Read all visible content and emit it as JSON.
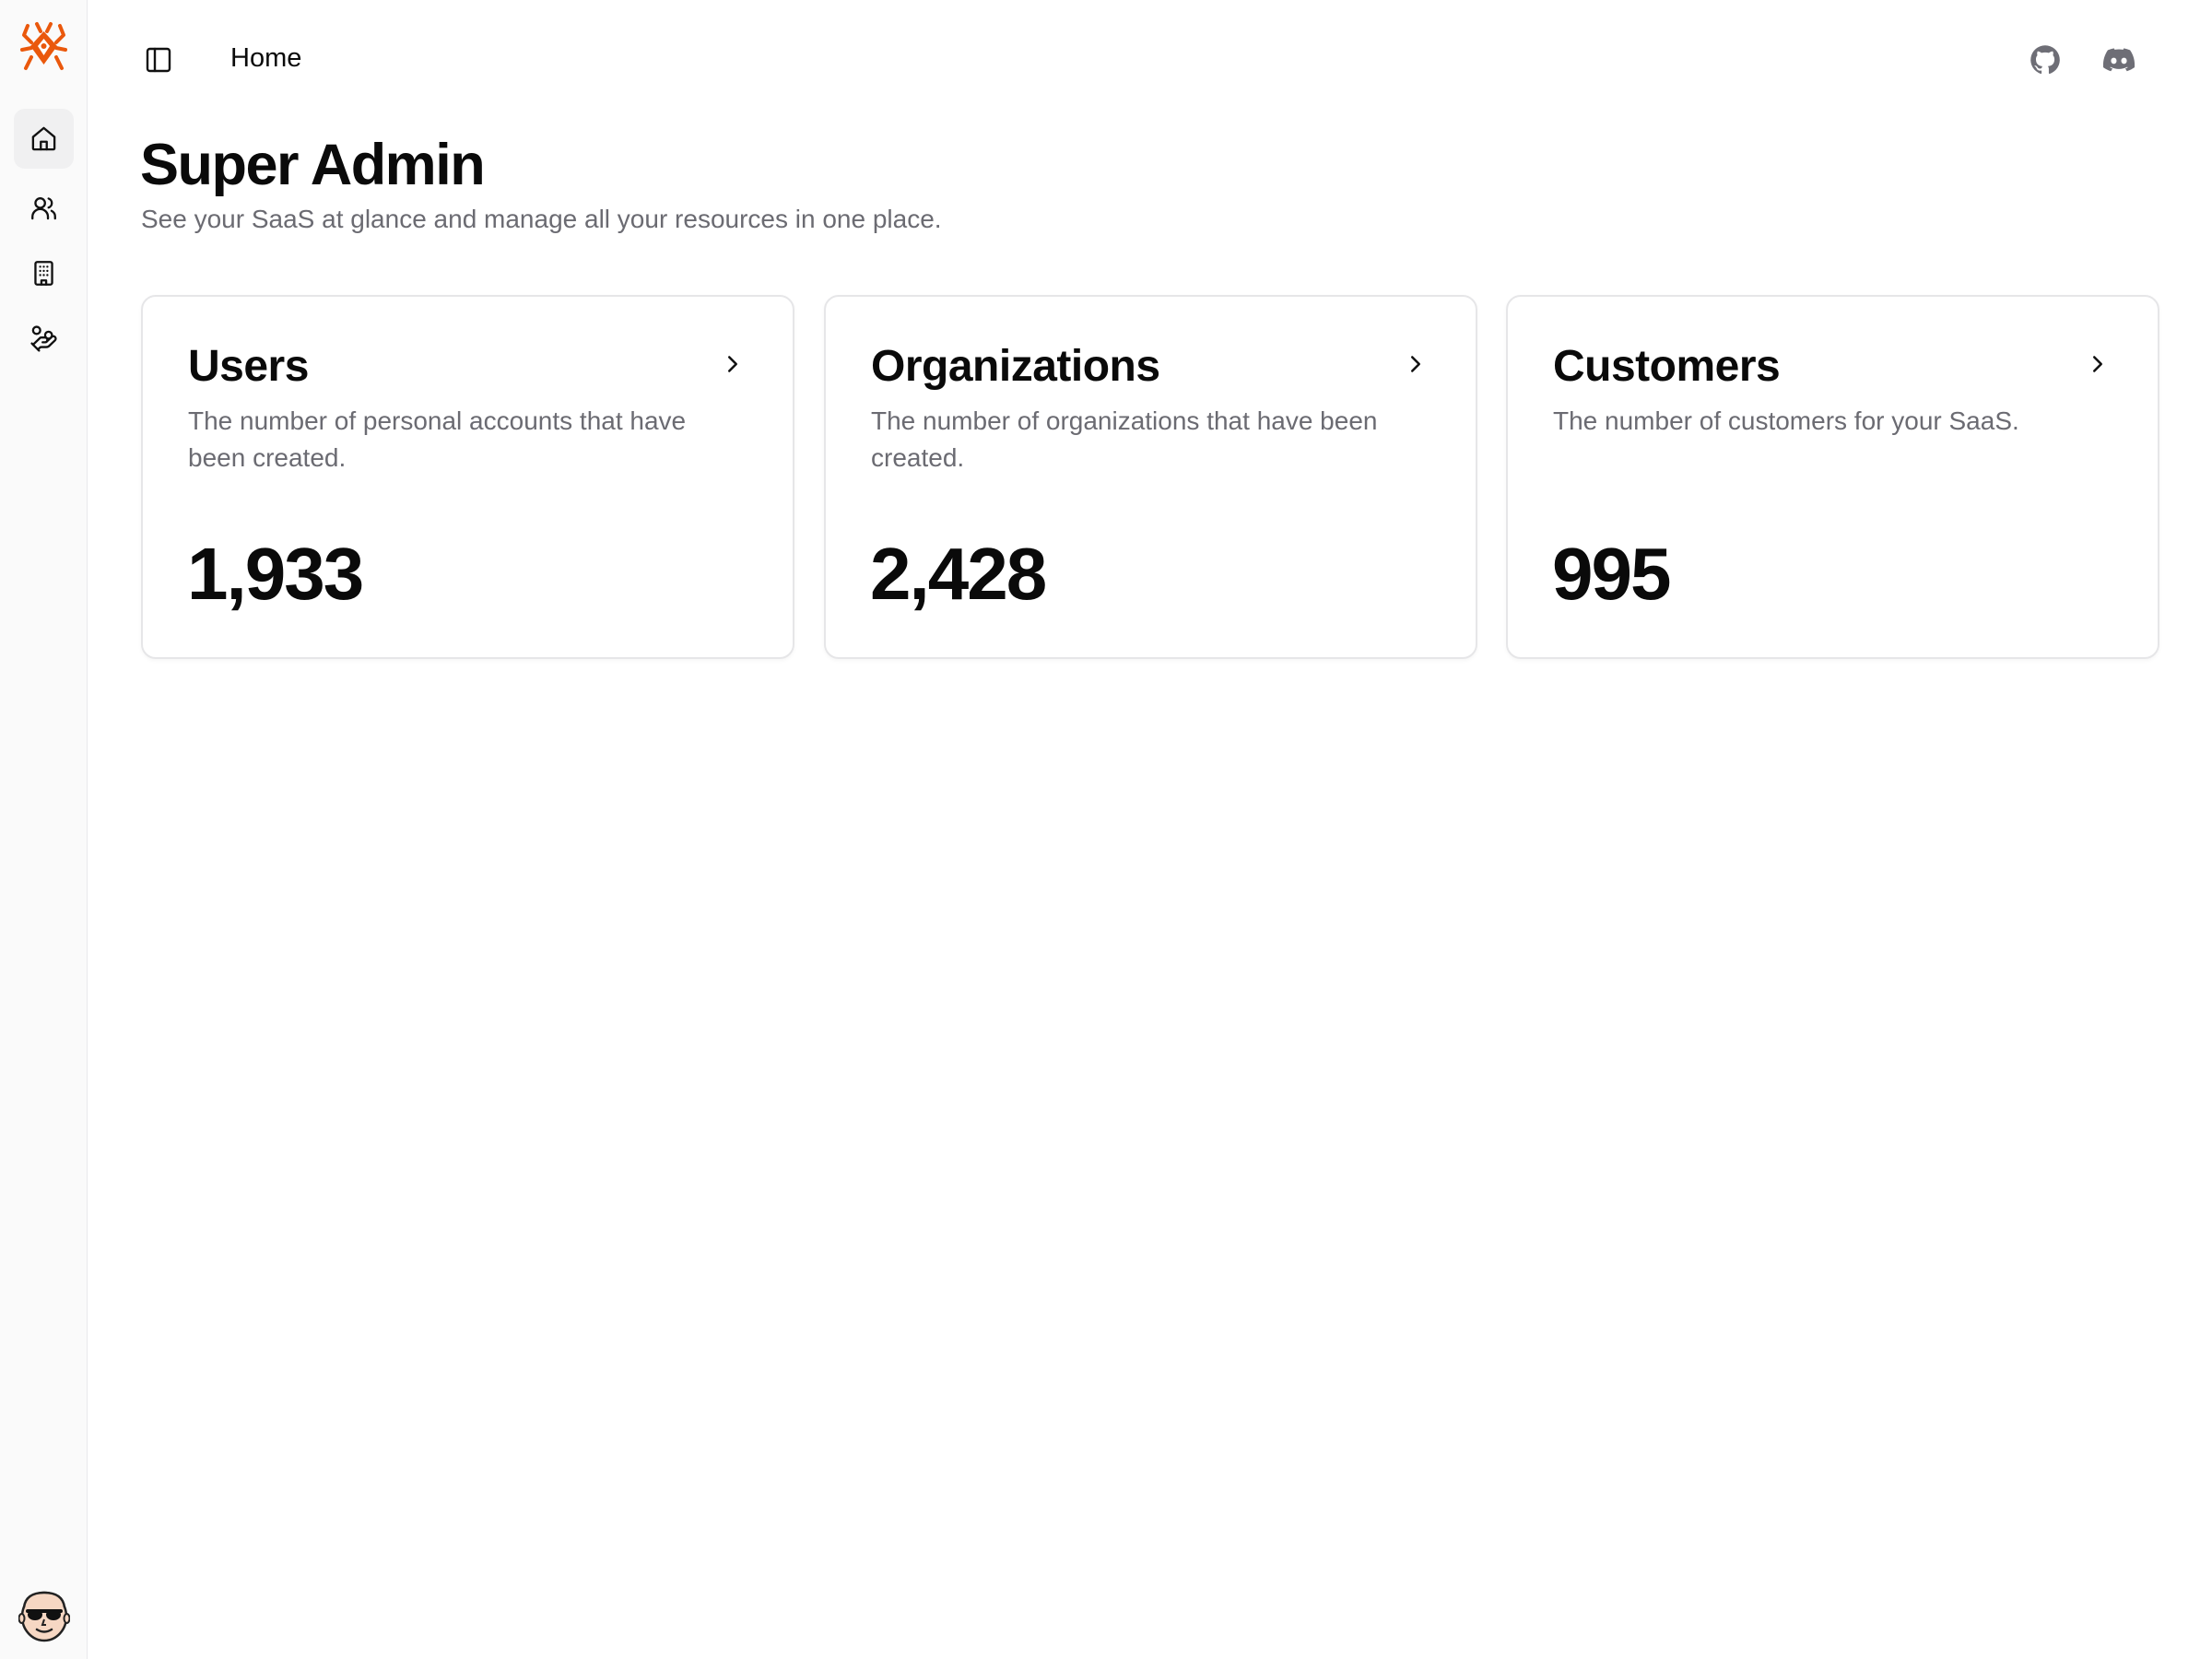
{
  "app": {
    "brand_color": "#ea580c",
    "sidebar_bg": "#fafafa"
  },
  "sidebar": {
    "items": [
      {
        "name": "home",
        "icon": "home-icon",
        "active": true
      },
      {
        "name": "users",
        "icon": "users-icon",
        "active": false
      },
      {
        "name": "organizations",
        "icon": "building-icon",
        "active": false
      },
      {
        "name": "customers",
        "icon": "hand-coins-icon",
        "active": false
      }
    ]
  },
  "header": {
    "breadcrumb": "Home",
    "links": [
      {
        "name": "github",
        "icon": "github-icon"
      },
      {
        "name": "discord",
        "icon": "discord-icon"
      }
    ]
  },
  "main": {
    "title": "Super Admin",
    "subtitle": "See your SaaS at glance and manage all your resources in one place.",
    "cards": [
      {
        "title": "Users",
        "description": "The number of personal accounts that have been created.",
        "value": "1,933"
      },
      {
        "title": "Organizations",
        "description": "The number of organizations that have been created.",
        "value": "2,428"
      },
      {
        "title": "Customers",
        "description": "The number of customers for your SaaS.",
        "value": "995"
      }
    ]
  }
}
